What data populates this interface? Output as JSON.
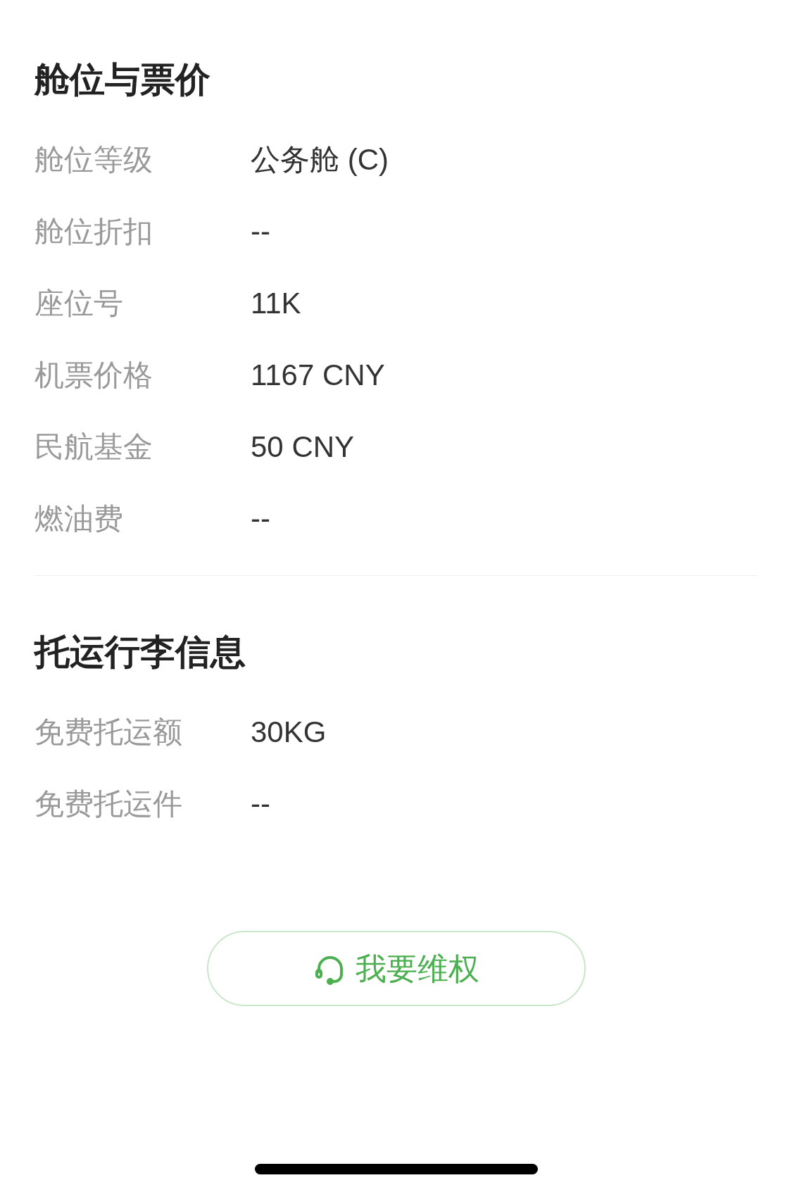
{
  "sections": [
    {
      "title": "舱位与票价",
      "rows": [
        {
          "label": "舱位等级",
          "value": "公务舱 (C)"
        },
        {
          "label": "舱位折扣",
          "value": "--"
        },
        {
          "label": "座位号",
          "value": "11K"
        },
        {
          "label": "机票价格",
          "value": "1167 CNY"
        },
        {
          "label": "民航基金",
          "value": "50 CNY"
        },
        {
          "label": "燃油费",
          "value": "--"
        }
      ]
    },
    {
      "title": "托运行李信息",
      "rows": [
        {
          "label": "免费托运额",
          "value": "30KG"
        },
        {
          "label": "免费托运件",
          "value": "--"
        }
      ]
    }
  ],
  "action_button": {
    "label": "我要维权"
  }
}
